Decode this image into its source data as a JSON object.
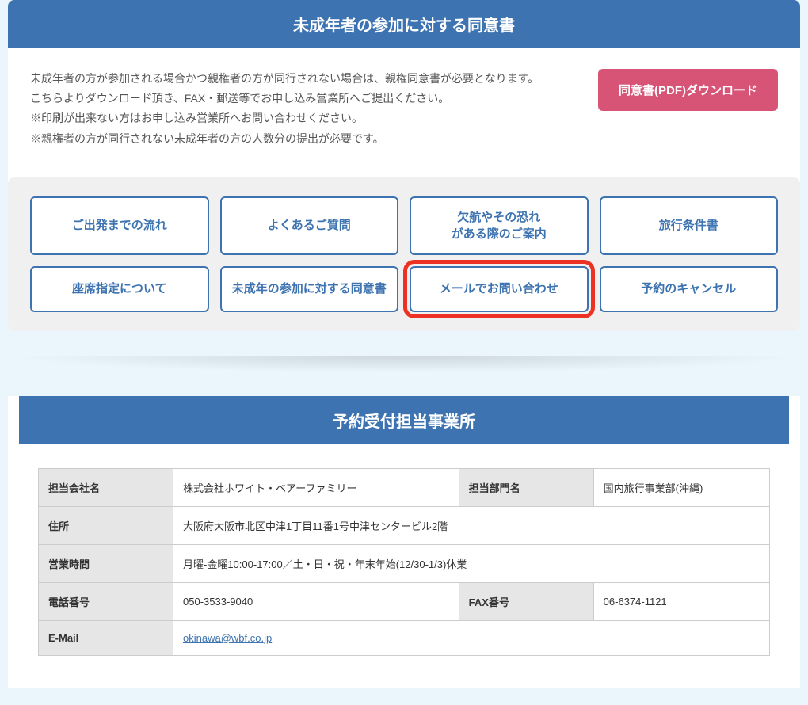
{
  "consent": {
    "header": "未成年者の参加に対する同意書",
    "line1": "未成年者の方が参加される場合かつ親権者の方が同行されない場合は、親権同意書が必要となります。",
    "line2": "こちらよりダウンロード頂き、FAX・郵送等でお申し込み営業所へご提出ください。",
    "line3": "※印刷が出来ない方はお申し込み営業所へお問い合わせください。",
    "line4": "※親権者の方が同行されない未成年者の方の人数分の提出が必要です。",
    "download": "同意書(PDF)ダウンロード"
  },
  "nav": {
    "items": [
      "ご出発までの流れ",
      "よくあるご質問",
      "欠航やその恐れ\nがある際のご案内",
      "旅行条件書",
      "座席指定について",
      "未成年の参加に対する同意書",
      "メールでお問い合わせ",
      "予約のキャンセル"
    ]
  },
  "office": {
    "header": "予約受付担当事業所",
    "labels": {
      "company": "担当会社名",
      "department": "担当部門名",
      "address": "住所",
      "hours": "営業時間",
      "tel": "電話番号",
      "fax": "FAX番号",
      "email": "E-Mail"
    },
    "values": {
      "company": "株式会社ホワイト・ベアーファミリー",
      "department": "国内旅行事業部(沖縄)",
      "address": "大阪府大阪市北区中津1丁目11番1号中津センタービル2階",
      "hours": "月曜-金曜10:00-17:00／土・日・祝・年末年始(12/30-1/3)休業",
      "tel": "050-3533-9040",
      "fax": "06-6374-1121",
      "email": "okinawa@wbf.co.jp"
    }
  }
}
